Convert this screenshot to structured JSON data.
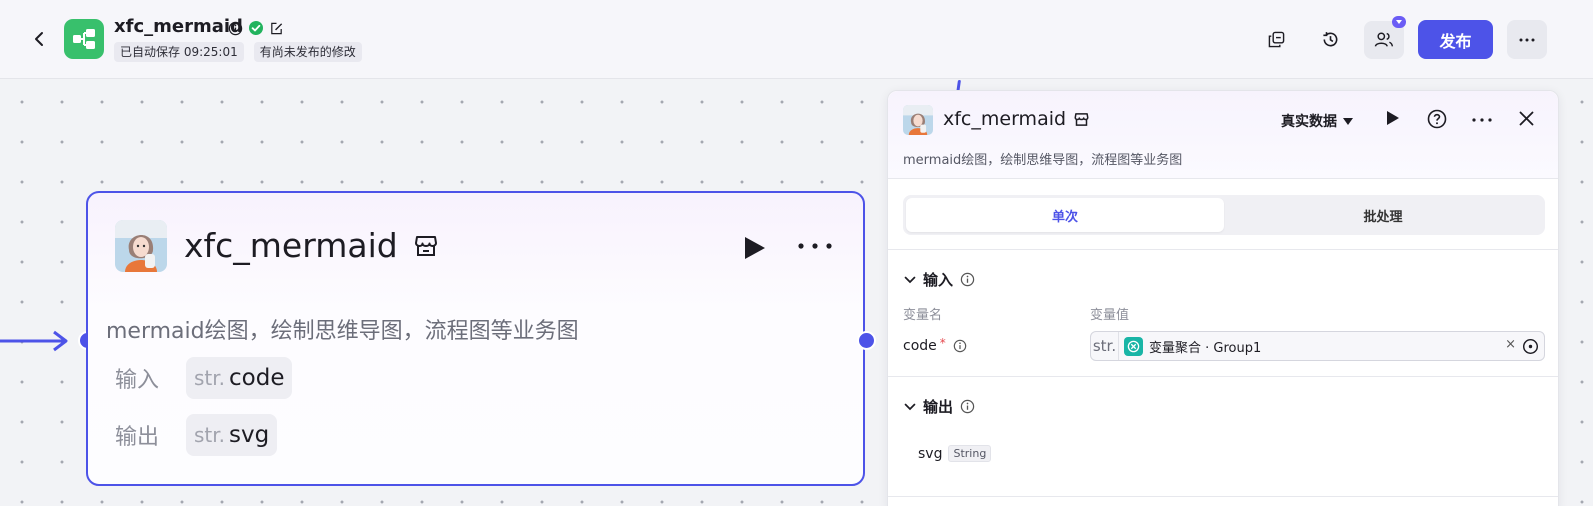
{
  "header": {
    "app_name": "xfc_mermaid",
    "autosave_tag": "已自动保存 09:25:01",
    "unpublished_tag": "有尚未发布的修改",
    "publish_label": "发布"
  },
  "node": {
    "title": "xfc_mermaid",
    "description": "mermaid绘图，绘制思维导图，流程图等业务图",
    "input_label": "输入",
    "input_type": "str.",
    "input_name": "code",
    "output_label": "输出",
    "output_type": "str.",
    "output_name": "svg"
  },
  "panel": {
    "title": "xfc_mermaid",
    "mode": "真实数据",
    "description": "mermaid绘图，绘制思维导图，流程图等业务图",
    "tabs": [
      {
        "label": "单次",
        "active": true
      },
      {
        "label": "批处理",
        "active": false
      }
    ],
    "input_section": "输入",
    "col_name": "变量名",
    "col_value": "变量值",
    "field_name": "code",
    "field_required": "*",
    "var_type": "str.",
    "var_value": "变量聚合 · Group1",
    "var_clear": "×",
    "output_section": "输出",
    "output_name": "svg",
    "output_type": "String"
  },
  "colors": {
    "accent": "#4d53e8",
    "brand_green": "#38c06c",
    "variable_teal": "#19b5a6",
    "required": "#e5484d"
  },
  "icons": [
    "back-arrow-icon",
    "workflow-logo-icon",
    "info-icon",
    "verified-check-icon",
    "edit-icon",
    "copy-icon",
    "history-icon",
    "collaborators-icon",
    "more-icon",
    "play-icon",
    "store-icon",
    "help-icon",
    "close-icon",
    "chevron-down-icon",
    "caret-down-icon",
    "variable-merge-icon",
    "target-icon"
  ]
}
